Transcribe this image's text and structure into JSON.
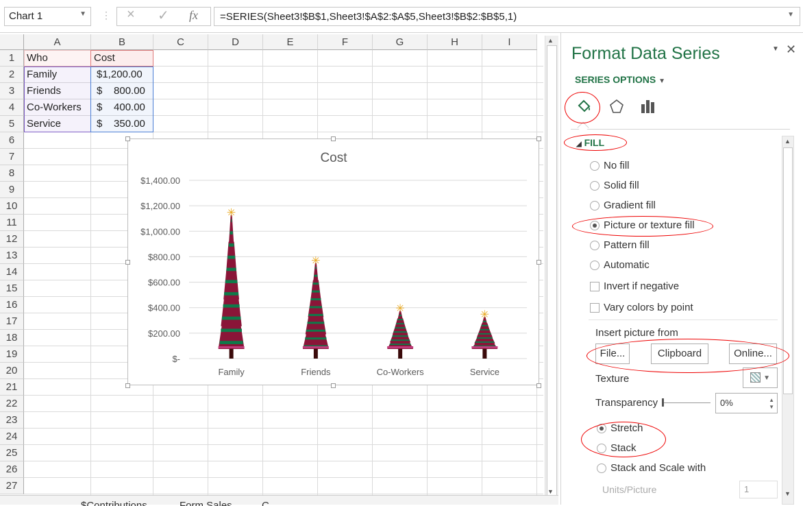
{
  "formula_bar": {
    "name_box": "Chart 1",
    "cancel_icon": "×",
    "enter_icon": "✓",
    "fx_label": "fx",
    "formula": "=SERIES(Sheet3!$B$1,Sheet3!$A$2:$A$5,Sheet3!$B$2:$B$5,1)"
  },
  "columns": [
    "A",
    "B",
    "C",
    "D",
    "E",
    "F",
    "G",
    "H",
    "I"
  ],
  "rows": [
    "1",
    "2",
    "3",
    "4",
    "5",
    "6",
    "7",
    "8",
    "9",
    "10",
    "11",
    "12",
    "13",
    "14",
    "15",
    "16",
    "17",
    "18",
    "19",
    "20",
    "21",
    "22",
    "23",
    "24",
    "25",
    "26",
    "27"
  ],
  "cells": [
    {
      "a": "Who",
      "b": "Cost"
    },
    {
      "a": "Family",
      "b": "$1,200.00"
    },
    {
      "a": "Friends",
      "b": "$    800.00"
    },
    {
      "a": "Co-Workers",
      "b": "$    400.00"
    },
    {
      "a": "Service",
      "b": "$    350.00"
    }
  ],
  "sheet_tabs": [
    "$Contributions",
    "Form Sales",
    "C"
  ],
  "chart_data": {
    "type": "bar",
    "title": "Cost",
    "categories": [
      "Family",
      "Friends",
      "Co-Workers",
      "Service"
    ],
    "values": [
      1200,
      800,
      400,
      350
    ],
    "ylim": [
      0,
      1400
    ],
    "yticks": [
      "$-",
      "$200.00",
      "$400.00",
      "$600.00",
      "$800.00",
      "$1,000.00",
      "$1,200.00",
      "$1,400.00"
    ],
    "grid": true,
    "fill": "picture (christmas tree)",
    "colors": {
      "tree_red": "#8a1538",
      "tree_green": "#0f7a4a",
      "tree_pink": "#c0397a",
      "star": "#e8a820",
      "trunk": "#3a0a0a"
    }
  },
  "panel": {
    "title": "Format Data Series",
    "series_options": "SERIES OPTIONS",
    "section": "FILL",
    "fill_options": [
      {
        "label": "No fill",
        "selected": false
      },
      {
        "label": "Solid fill",
        "selected": false
      },
      {
        "label": "Gradient fill",
        "selected": false
      },
      {
        "label": "Picture or texture fill",
        "selected": true
      },
      {
        "label": "Pattern fill",
        "selected": false
      },
      {
        "label": "Automatic",
        "selected": false
      }
    ],
    "invert_if_negative": "Invert if negative",
    "vary_colors": "Vary colors by point",
    "insert_picture_from": "Insert picture from",
    "file_button": "File...",
    "clipboard_button": "Clipboard",
    "online_button": "Online...",
    "texture_label": "Texture",
    "transparency_label": "Transparency",
    "transparency_value": "0%",
    "stretch": "Stretch",
    "stack": "Stack",
    "stack_scale": "Stack and Scale with",
    "units_picture": "Units/Picture",
    "units_value": "1",
    "accent": "#217346",
    "annotation_color": "#e00000"
  }
}
